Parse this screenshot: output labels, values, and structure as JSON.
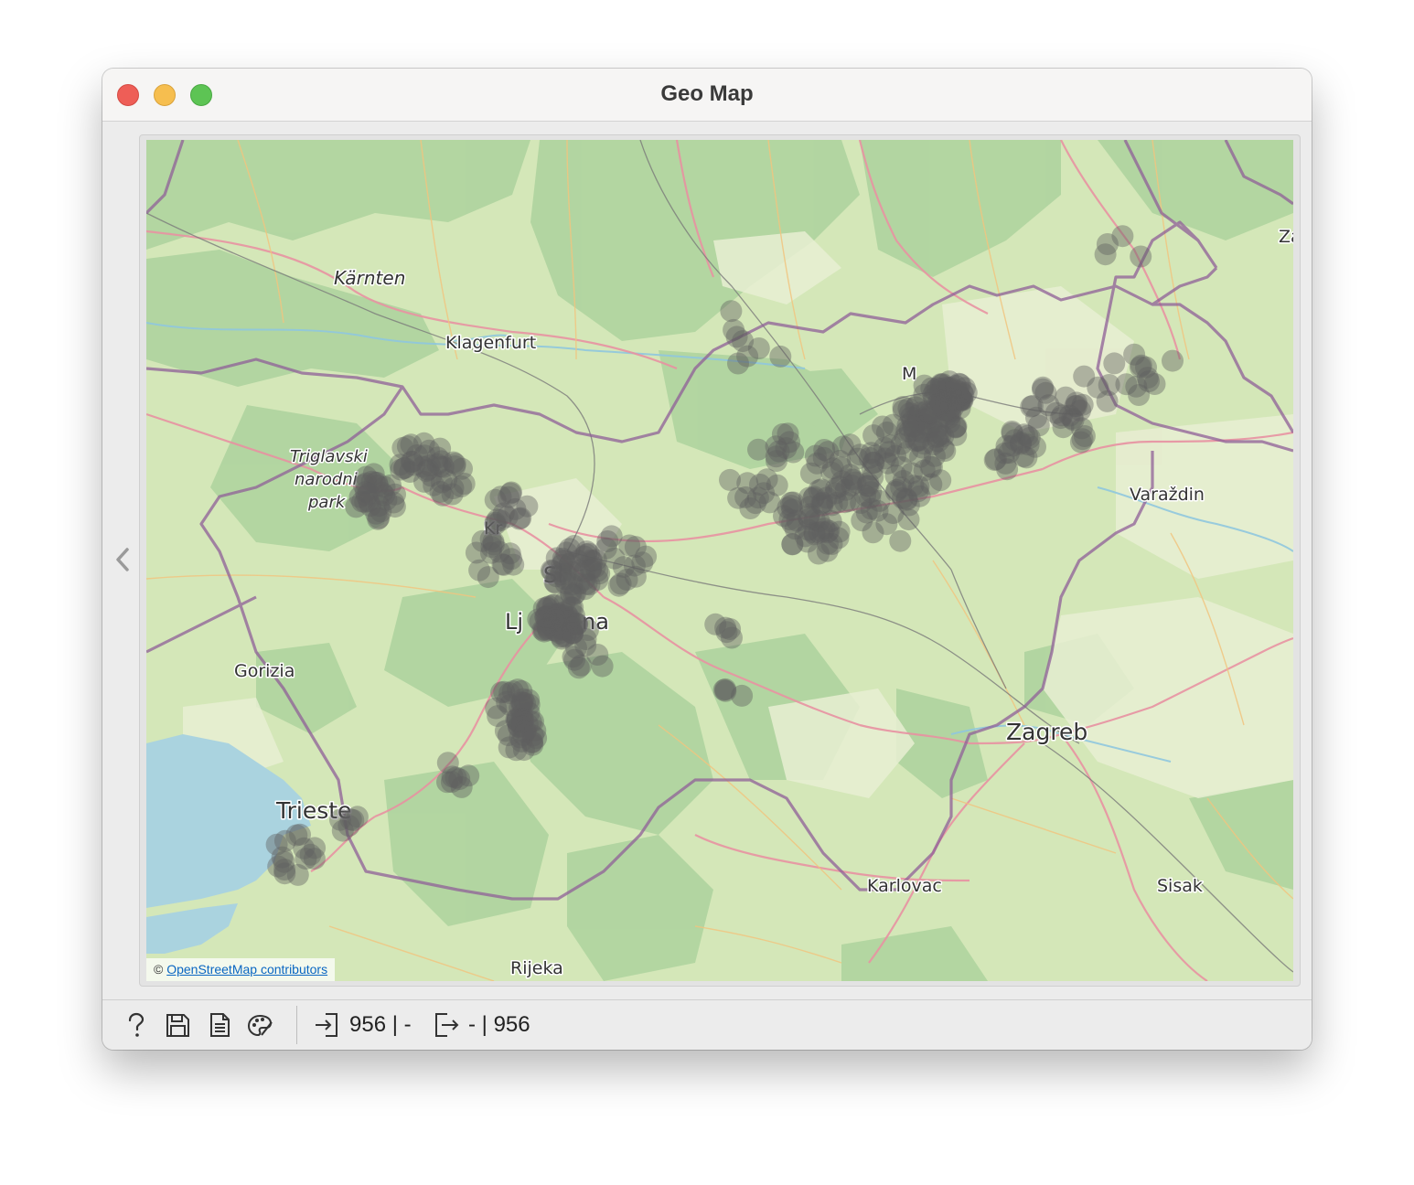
{
  "window": {
    "title": "Geo Map"
  },
  "map": {
    "attribution_prefix": "©",
    "attribution_link": "OpenStreetMap contributors",
    "place_labels": [
      {
        "text": "Kärnten",
        "kind": "region"
      },
      {
        "text": "Klagenfurt",
        "kind": "city"
      },
      {
        "text": "Triglavski",
        "kind": "park"
      },
      {
        "text": "narodni",
        "kind": "park"
      },
      {
        "text": "park",
        "kind": "park"
      },
      {
        "text": "Kr",
        "kind": "city"
      },
      {
        "text": "Sl",
        "kind": "country"
      },
      {
        "text": "Lj",
        "kind": "city"
      },
      {
        "text": "na",
        "kind": "city"
      },
      {
        "text": "Gorizia",
        "kind": "city"
      },
      {
        "text": "Trieste",
        "kind": "city-large"
      },
      {
        "text": "Rijeka",
        "kind": "city"
      },
      {
        "text": "Karlovac",
        "kind": "city"
      },
      {
        "text": "Zagreb",
        "kind": "city-large"
      },
      {
        "text": "Sisak",
        "kind": "city"
      },
      {
        "text": "Varaždin",
        "kind": "city"
      },
      {
        "text": "M",
        "kind": "city"
      },
      {
        "text": "Za",
        "kind": "city"
      }
    ],
    "marker_color": "#5f5f5f",
    "colors": {
      "land": "#cfe5b3",
      "forest": "#add19e",
      "sea": "#aad3df",
      "border": "#8f5f98",
      "road_major": "#e892a2",
      "road_minor": "#f4c27a"
    }
  },
  "statusbar": {
    "icons": [
      "help-icon",
      "save-icon",
      "report-icon",
      "palette-icon"
    ],
    "input_summary": "956 | -",
    "output_summary": "- | 956"
  }
}
